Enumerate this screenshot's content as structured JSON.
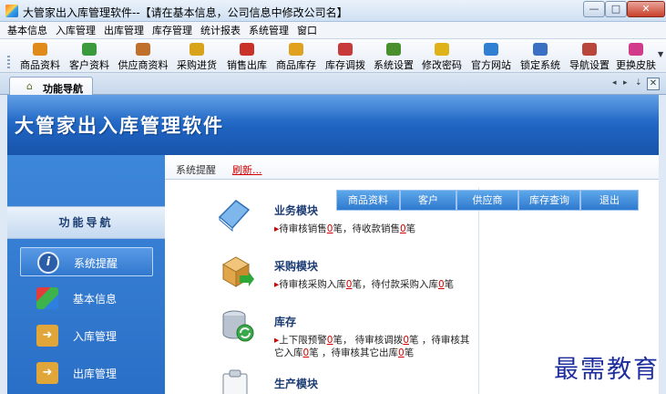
{
  "window": {
    "title": "大管家出入库管理软件--【请在基本信息，公司信息中修改公司名】",
    "min_glyph": "—",
    "max_glyph": "□",
    "close_glyph": "✕"
  },
  "menu": [
    "基本信息",
    "入库管理",
    "出库管理",
    "库存管理",
    "统计报表",
    "系统管理",
    "窗口"
  ],
  "toolbar": [
    {
      "label": "商品资料",
      "icon": "product-icon",
      "color": "#e08a1c"
    },
    {
      "label": "客户资料",
      "icon": "customer-icon",
      "color": "#3b9a3b"
    },
    {
      "label": "供应商资料",
      "icon": "supplier-icon",
      "color": "#c0702a"
    },
    {
      "label": "采购进货",
      "icon": "purchase-icon",
      "color": "#d8a21a"
    },
    {
      "label": "销售出库",
      "icon": "sales-icon",
      "color": "#c83228"
    },
    {
      "label": "商品库存",
      "icon": "stock-icon",
      "color": "#e0a21e"
    },
    {
      "label": "库存调拨",
      "icon": "transfer-icon",
      "color": "#c83a3a"
    },
    {
      "label": "系统设置",
      "icon": "settings-icon",
      "color": "#4a8f2e"
    },
    {
      "label": "修改密码",
      "icon": "password-icon",
      "color": "#e0b21a"
    },
    {
      "label": "官方网站",
      "icon": "website-icon",
      "color": "#2f7fd2"
    },
    {
      "label": "锁定系统",
      "icon": "lock-icon",
      "color": "#3a6fc4"
    },
    {
      "label": "导航设置",
      "icon": "nav-settings-icon",
      "color": "#b8463a"
    },
    {
      "label": "更换皮肤",
      "icon": "skin-icon",
      "color": "#d23a8a"
    }
  ],
  "doc_tab": {
    "label": "功能导航"
  },
  "strip_controls": {
    "left": "◂",
    "right": "▸",
    "pin": "⇣",
    "close": "✕"
  },
  "banner": {
    "title": "大管家出入库管理软件"
  },
  "nav": {
    "header": "功能导航",
    "items": [
      {
        "label": "系统提醒",
        "icon": "info-icon",
        "active": true
      },
      {
        "label": "基本信息",
        "icon": "cubes-icon",
        "active": false
      },
      {
        "label": "入库管理",
        "icon": "box-in-icon",
        "active": false
      },
      {
        "label": "出库管理",
        "icon": "box-out-icon",
        "active": false
      }
    ]
  },
  "content": {
    "remind": "系统提醒",
    "refresh": "刷新...",
    "quick_buttons": [
      "商品资料",
      "客户",
      "供应商",
      "库存查询",
      "退出"
    ],
    "modules": [
      {
        "title": "业务模块",
        "lines": [
          [
            "待审核销售",
            "0",
            "笔，待收款销售",
            "0",
            "笔"
          ]
        ]
      },
      {
        "title": "采购模块",
        "lines": [
          [
            "待审核采购入库",
            "0",
            "笔，待付款采购入库",
            "0",
            "笔"
          ]
        ]
      },
      {
        "title": "库存",
        "lines": [
          [
            "上下限预警",
            "0",
            "笔，  待审核调拨",
            "0",
            "笔  ，待审核其"
          ],
          [
            "它入库",
            "0",
            "笔 ，待审核其它出库",
            "0",
            "笔"
          ]
        ]
      },
      {
        "title": "生产模块",
        "lines": []
      }
    ]
  },
  "watermark": "最需教育"
}
